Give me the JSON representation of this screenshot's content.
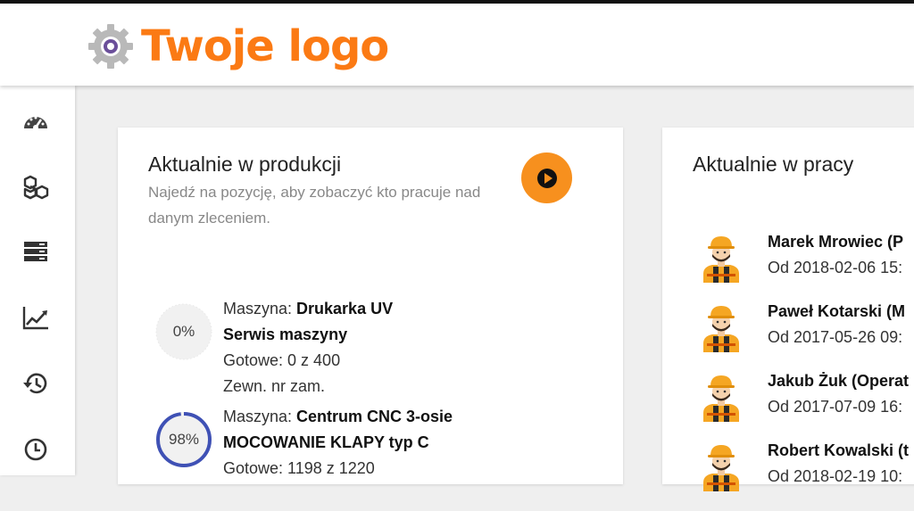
{
  "header": {
    "logo_text": "Twoje logo"
  },
  "sidebar": {
    "items": [
      {
        "icon": "dashboard-icon"
      },
      {
        "icon": "boxes-icon"
      },
      {
        "icon": "server-icon"
      },
      {
        "icon": "chart-line-icon"
      },
      {
        "icon": "history-icon"
      },
      {
        "icon": "clock-icon"
      }
    ]
  },
  "production": {
    "title": "Aktualnie w produkcji",
    "subtitle": "Najedź na pozycję, aby zobaczyć kto pracuje nad danym zleceniem.",
    "items": [
      {
        "progress_label": "0%",
        "progress": 0,
        "machine_prefix": "Maszyna: ",
        "machine": "Drukarka UV",
        "task": "Serwis maszyny",
        "done": "Gotowe: 0 z 400",
        "order": "Zewn. nr zam."
      },
      {
        "progress_label": "98%",
        "progress": 0.98,
        "machine_prefix": "Maszyna: ",
        "machine": "Centrum CNC 3-osie",
        "task": "MOCOWANIE KLAPY typ C",
        "done": "Gotowe: 1198 z 1220",
        "order": ""
      }
    ]
  },
  "work": {
    "title": "Aktualnie w pracy",
    "workers": [
      {
        "name": "Marek Mrowiec (P",
        "since": "Od 2018-02-06 15:"
      },
      {
        "name": "Paweł Kotarski (M",
        "since": "Od 2017-05-26 09:"
      },
      {
        "name": "Jakub Żuk (Operat",
        "since": "Od 2017-07-09 16:"
      },
      {
        "name": "Robert Kowalski (t",
        "since": "Od 2018-02-19 10:"
      }
    ]
  },
  "colors": {
    "accent": "#f7901e",
    "logo": "#fb7a14",
    "progress": "#3f51b5",
    "gauge_bg": "#f1f1f1"
  }
}
